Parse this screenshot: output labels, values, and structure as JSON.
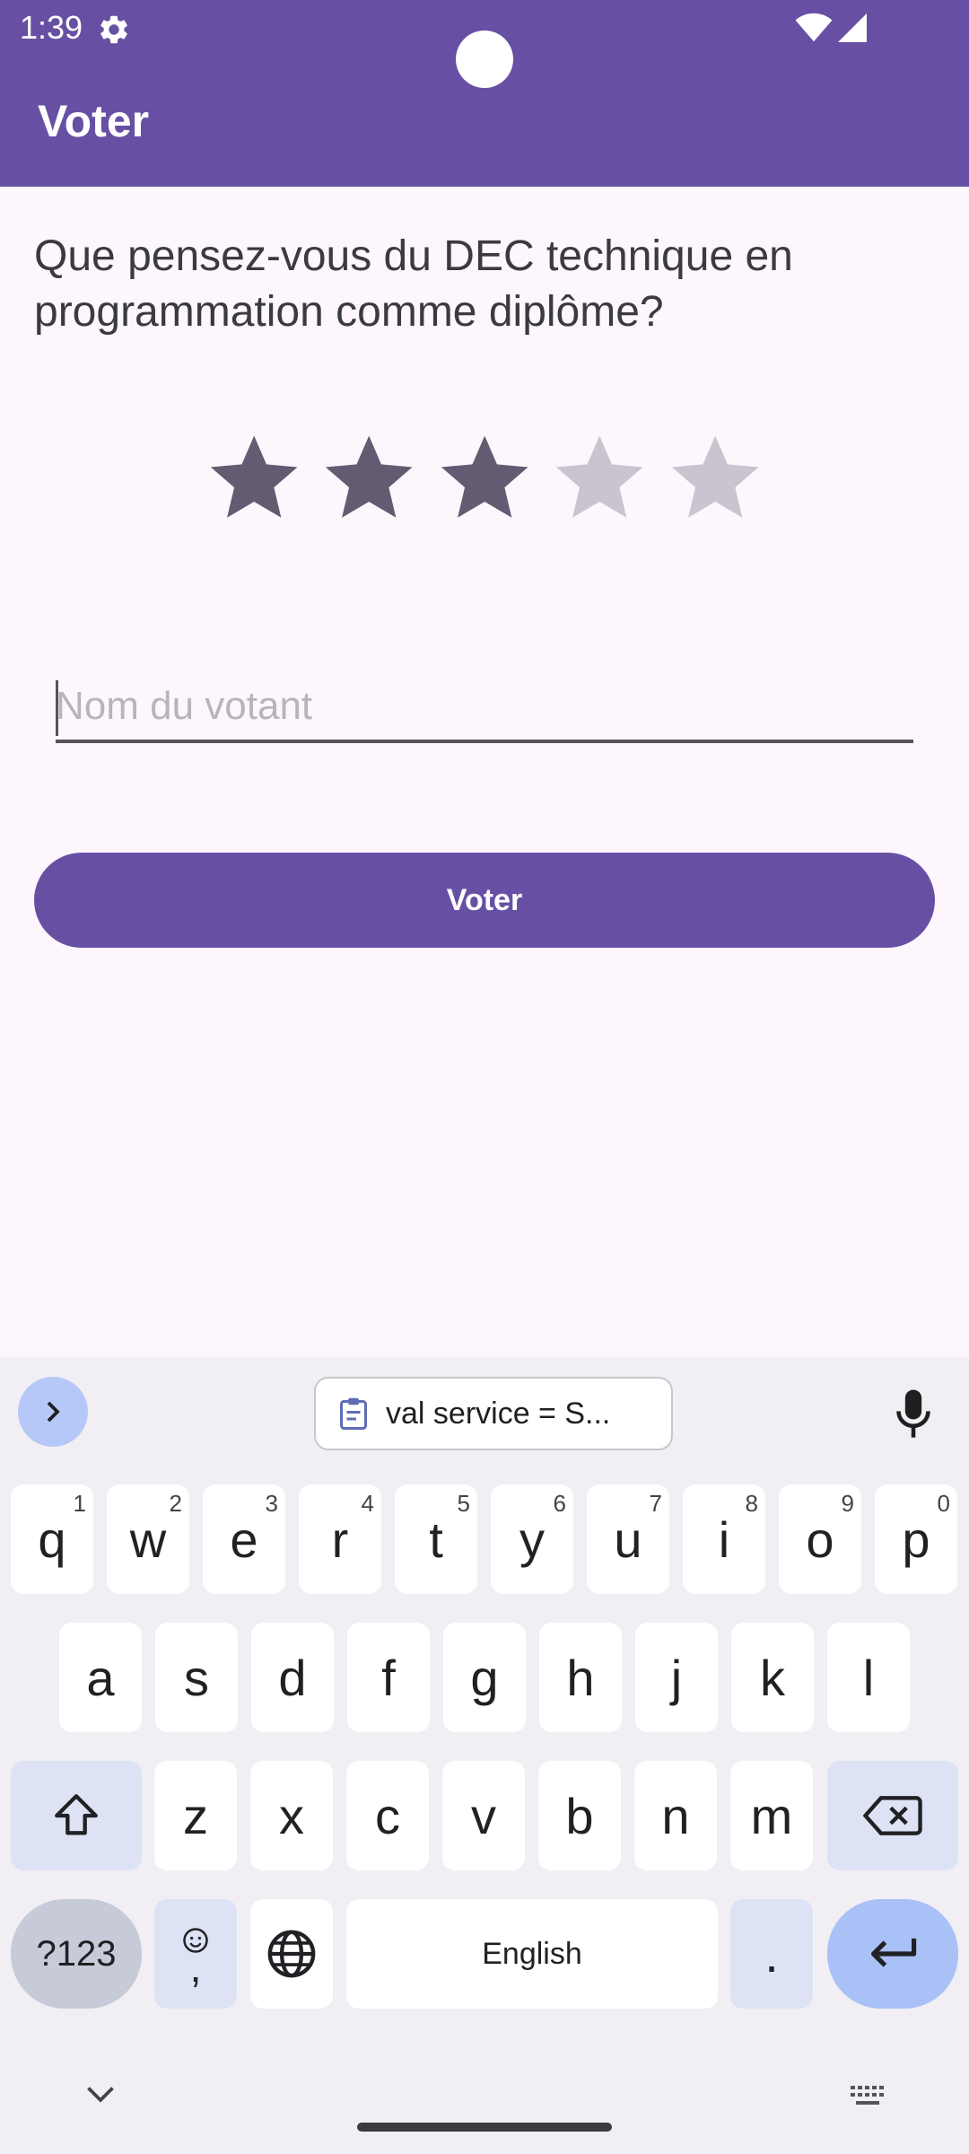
{
  "status_bar": {
    "time": "1:39"
  },
  "app_bar": {
    "title": "Voter"
  },
  "question": "Que pensez-vous du DEC technique en programmation comme diplôme?",
  "rating": {
    "value": 3,
    "max": 5,
    "filled_color": "#625b71",
    "empty_color": "#cac4d0"
  },
  "name_field": {
    "placeholder": "Nom du votant",
    "value": ""
  },
  "vote_button": {
    "label": "Voter"
  },
  "keyboard": {
    "clipboard_chip": "val service = S...",
    "row1": [
      {
        "key": "q",
        "hint": "1"
      },
      {
        "key": "w",
        "hint": "2"
      },
      {
        "key": "e",
        "hint": "3"
      },
      {
        "key": "r",
        "hint": "4"
      },
      {
        "key": "t",
        "hint": "5"
      },
      {
        "key": "y",
        "hint": "6"
      },
      {
        "key": "u",
        "hint": "7"
      },
      {
        "key": "i",
        "hint": "8"
      },
      {
        "key": "o",
        "hint": "9"
      },
      {
        "key": "p",
        "hint": "0"
      }
    ],
    "row2": [
      "a",
      "s",
      "d",
      "f",
      "g",
      "h",
      "j",
      "k",
      "l"
    ],
    "row3": [
      "z",
      "x",
      "c",
      "v",
      "b",
      "n",
      "m"
    ],
    "sym_label": "?123",
    "emoji_comma_label": ",",
    "space_label": "English",
    "period_label": "."
  },
  "colors": {
    "primary": "#6750a4",
    "background": "#fdf7fd",
    "keyboard_bg": "#f1eff4"
  }
}
